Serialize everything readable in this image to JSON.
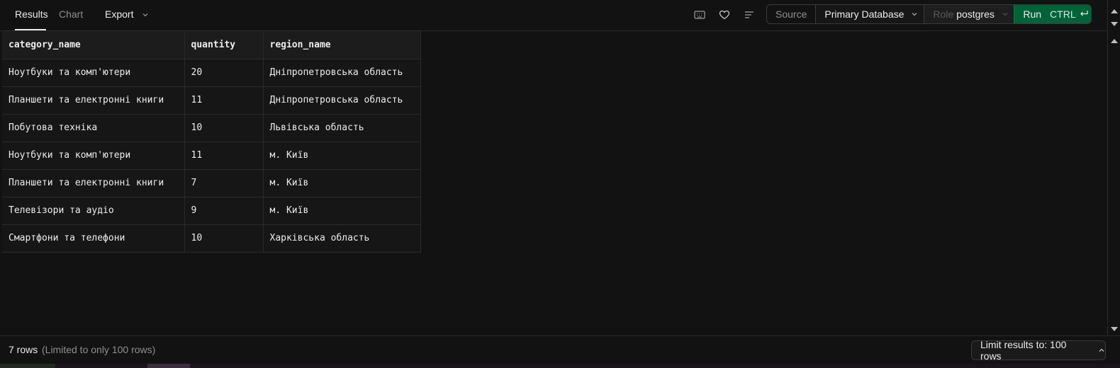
{
  "toolbar": {
    "tabs": [
      {
        "label": "Results",
        "active": true
      },
      {
        "label": "Chart",
        "active": false
      }
    ],
    "export_label": "Export",
    "icons": [
      "keyboard-icon",
      "heart-icon",
      "align-left-icon"
    ],
    "source_label": "Source",
    "database_label": "Primary Database",
    "role_label": "Role",
    "role_value": "postgres",
    "run_label": "Run",
    "run_shortcut": "CTRL"
  },
  "grid": {
    "columns": [
      "category_name",
      "quantity",
      "region_name"
    ],
    "rows": [
      [
        "Ноутбуки та комп'ютери",
        "20",
        "Дніпропетровська область"
      ],
      [
        "Планшети та електронні книги",
        "11",
        "Дніпропетровська область"
      ],
      [
        "Побутова техніка",
        "10",
        "Львівська область"
      ],
      [
        "Ноутбуки та комп'ютери",
        "11",
        "м. Київ"
      ],
      [
        "Планшети та електронні книги",
        "7",
        "м. Київ"
      ],
      [
        "Телевізори та аудіо",
        "9",
        "м. Київ"
      ],
      [
        "Смартфони та телефони",
        "10",
        "Харківська область"
      ]
    ]
  },
  "footer": {
    "row_count": "7 rows",
    "row_limit_note": "(Limited to only 100 rows)",
    "limit_button": "Limit results to: 100 rows"
  },
  "colors": {
    "background": "#121212",
    "run_button": "#006239",
    "border": "#2a2a2a",
    "text": "#ededed",
    "muted_text": "#8f8f8f"
  }
}
